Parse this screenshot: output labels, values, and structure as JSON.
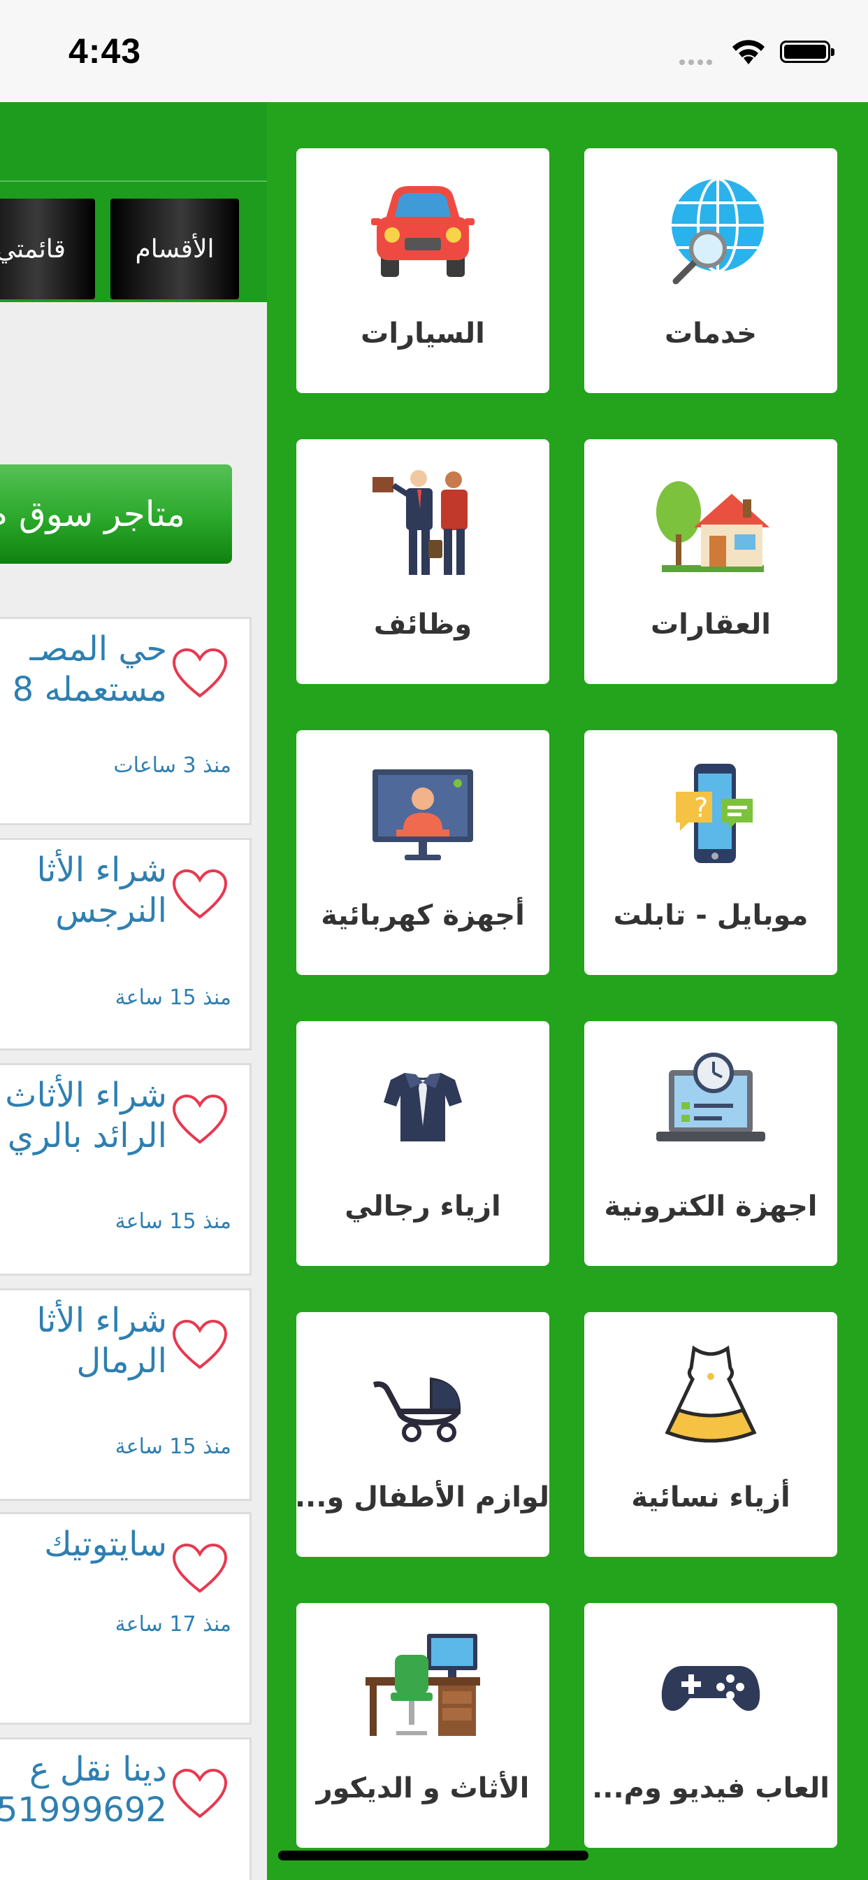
{
  "status_bar": {
    "time": "4:43",
    "icons": [
      "signal-dots-icon",
      "wifi-icon",
      "battery-icon"
    ]
  },
  "main": {
    "tabs": [
      {
        "label": "الأقسام"
      },
      {
        "label": "قائمتي"
      }
    ],
    "stores_button": "متاجر سوق م",
    "ads": [
      {
        "title_line1": "حي المصـ",
        "title_line2": "مستعمله 8",
        "time": "منذ 3 ساعات"
      },
      {
        "title_line1": "شراء الأثا",
        "title_line2": "النرجس",
        "time": "منذ 15 ساعة"
      },
      {
        "title_line1": "شراء الأثاث",
        "title_line2": "الرائد بالري",
        "time": "منذ 15 ساعة"
      },
      {
        "title_line1": "شراء الأثا",
        "title_line2": "الرمال",
        "time": "منذ 15 ساعة"
      },
      {
        "title_line1": "سايتوتيك",
        "title_line2": "",
        "time": "منذ 17 ساعة"
      },
      {
        "title_line1": "دينا نقل ع",
        "title_line2": "51999692",
        "time": ""
      }
    ]
  },
  "drawer": {
    "background_color": "#24a41c",
    "categories": [
      {
        "label": "خدمات",
        "icon": "globe-search-icon"
      },
      {
        "label": "السيارات",
        "icon": "car-icon"
      },
      {
        "label": "العقارات",
        "icon": "house-icon"
      },
      {
        "label": "وظائف",
        "icon": "job-seekers-icon"
      },
      {
        "label": "موبايل - تابلت",
        "icon": "mobile-chat-icon"
      },
      {
        "label": "أجهزة كهربائية",
        "icon": "tv-monitor-icon"
      },
      {
        "label": "اجهزة الكترونية",
        "icon": "laptop-clock-icon"
      },
      {
        "label": "ازياء رجالي",
        "icon": "shirt-tie-icon"
      },
      {
        "label": "أزياء نسائية",
        "icon": "dress-icon"
      },
      {
        "label": "لوازم الأطفال و...",
        "icon": "baby-stroller-icon"
      },
      {
        "label": "العاب فيديو وم...",
        "icon": "game-controller-icon"
      },
      {
        "label": "الأثاث و الديكور",
        "icon": "desk-furniture-icon"
      }
    ]
  }
}
